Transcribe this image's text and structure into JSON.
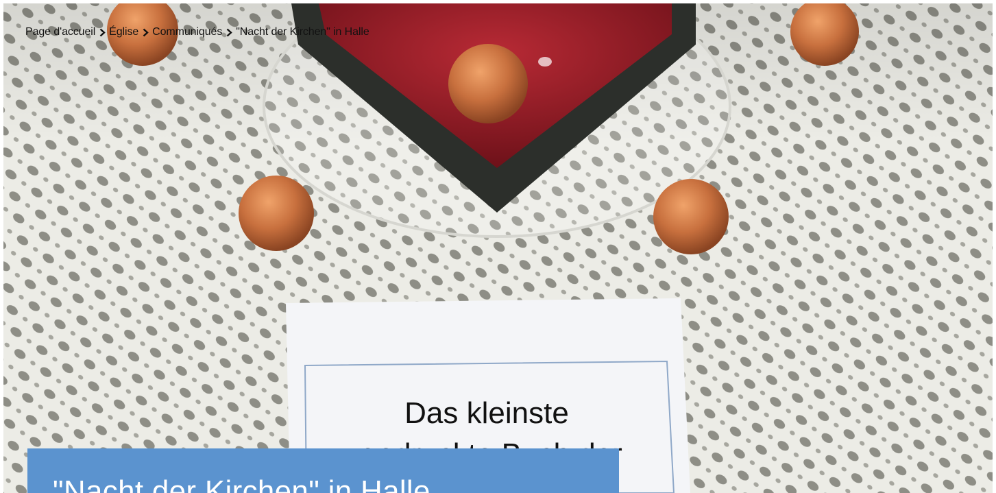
{
  "breadcrumb": {
    "items": [
      "Page d'accueil",
      "Église",
      "Communiqués",
      "\"Nacht der Kirchen\" in Halle"
    ]
  },
  "hero": {
    "image_alt": "Coins around a small book on a lace doily",
    "card_text_line1": "Das kleinste",
    "card_text_line2": "gedruckte Buch der"
  },
  "page": {
    "title": "\"Nacht der Kirchen\" in Halle"
  },
  "colors": {
    "title_bg": "#5b93cf",
    "lace": "#ecece6",
    "coin": "#c8703e",
    "box_red": "#8a1a24"
  }
}
